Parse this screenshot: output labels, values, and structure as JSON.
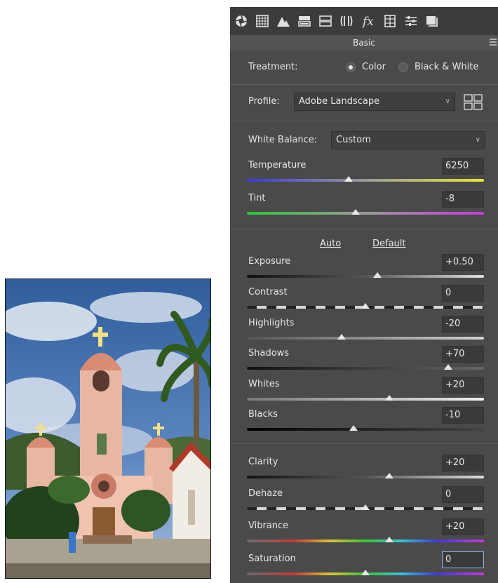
{
  "panel": {
    "section_title": "Basic",
    "tabs": [
      "basic-icon",
      "tone-curve-icon",
      "detail-icon",
      "hsl-icon",
      "split-toning-icon",
      "lens-icon",
      "fx-icon",
      "calibration-icon",
      "presets-icon",
      "snapshots-icon"
    ]
  },
  "treatment": {
    "label": "Treatment:",
    "options": [
      "Color",
      "Black & White"
    ],
    "selected": "Color"
  },
  "profile": {
    "label": "Profile:",
    "value": "Adobe Landscape"
  },
  "white_balance": {
    "label": "White Balance:",
    "value": "Custom"
  },
  "auto_label": "Auto",
  "default_label": "Default",
  "sliders": [
    {
      "label": "Temperature",
      "value": "6250",
      "level": 0.43
    },
    {
      "label": "Tint",
      "value": "-8",
      "level": 0.46
    },
    {
      "label": "Exposure",
      "value": "+0.50",
      "level": 0.55
    },
    {
      "label": "Contrast",
      "value": "0",
      "level": 0.5
    },
    {
      "label": "Highlights",
      "value": "-20",
      "level": 0.4
    },
    {
      "label": "Shadows",
      "value": "+70",
      "level": 0.85
    },
    {
      "label": "Whites",
      "value": "+20",
      "level": 0.6
    },
    {
      "label": "Blacks",
      "value": "-10",
      "level": 0.45
    },
    {
      "label": "Clarity",
      "value": "+20",
      "level": 0.6
    },
    {
      "label": "Dehaze",
      "value": "0",
      "level": 0.5
    },
    {
      "label": "Vibrance",
      "value": "+20",
      "level": 0.6
    },
    {
      "label": "Saturation",
      "value": "0",
      "level": 0.5
    }
  ],
  "colors": {
    "panel_bg": "#4a4a4a",
    "tabbar_bg": "#3c3c3c",
    "value_box": "#3a3a3a",
    "focus": "#8fb5e8"
  }
}
